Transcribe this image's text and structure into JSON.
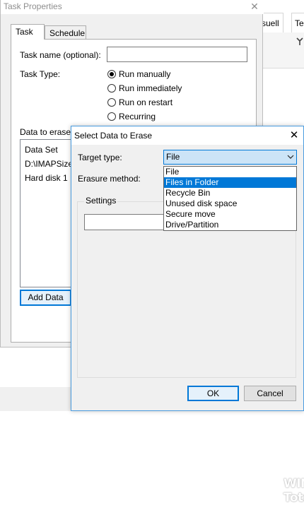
{
  "background_app": {
    "tabs": [
      "suell",
      "Tes"
    ]
  },
  "task_properties": {
    "title": "Task Properties",
    "close_glyph": "✕",
    "tabs": [
      {
        "label": "Task",
        "active": true
      },
      {
        "label": "Schedule",
        "active": false
      }
    ],
    "task_name_label": "Task name (optional):",
    "task_name_value": "",
    "task_type_label": "Task Type:",
    "task_type_options": [
      {
        "label": "Run manually",
        "checked": true
      },
      {
        "label": "Run immediately",
        "checked": false
      },
      {
        "label": "Run on restart",
        "checked": false
      },
      {
        "label": "Recurring",
        "checked": false
      }
    ],
    "data_to_erase_label": "Data to erase:",
    "data_list": {
      "header": "Data Set",
      "rows": [
        "D:\\IMAPSize",
        "Hard disk 1"
      ]
    },
    "add_data_button": "Add Data"
  },
  "select_data_dialog": {
    "title": "Select Data to Erase",
    "close_glyph": "✕",
    "target_type_label": "Target type:",
    "target_type_value": "File",
    "target_type_options": [
      {
        "label": "File",
        "selected": false
      },
      {
        "label": "Files in Folder",
        "selected": true
      },
      {
        "label": "Recycle Bin",
        "selected": false
      },
      {
        "label": "Unused disk space",
        "selected": false
      },
      {
        "label": "Secure move",
        "selected": false
      },
      {
        "label": "Drive/Partition",
        "selected": false
      }
    ],
    "erasure_method_label": "Erasure method:",
    "settings_group_label": "Settings",
    "ok_button": "OK",
    "cancel_button": "Cancel"
  },
  "watermark_text": "WIN Tota",
  "colors": {
    "accent": "#0078d7",
    "combo_fill": "#cce4f7",
    "window_bg": "#f0f0f0"
  }
}
